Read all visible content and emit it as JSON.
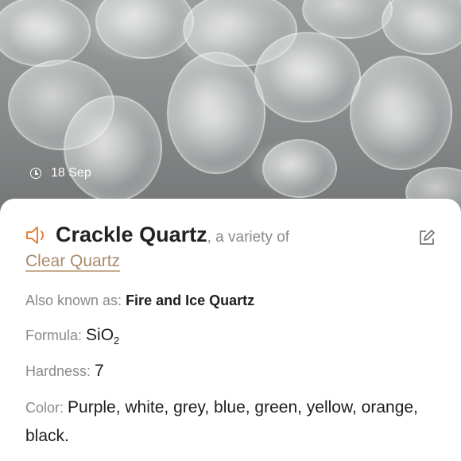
{
  "header": {
    "date": "18 Sep",
    "date_icon": "clock-icon"
  },
  "mineral": {
    "name": "Crackle Quartz",
    "variety_text": ", a variety of",
    "parent": "Clear Quartz",
    "audio_icon": "speaker-icon",
    "edit_icon": "edit-icon"
  },
  "properties": {
    "aka_label": "Also known as: ",
    "aka_value": "Fire and Ice Quartz",
    "formula_label": "Formula: ",
    "formula_main": "SiO",
    "formula_sub": "2",
    "hardness_label": "Hardness: ",
    "hardness_value": "7",
    "color_label": "Color: ",
    "color_value": "Purple, white, grey, blue, green, yellow, orange, black."
  },
  "colors": {
    "accent": "#e8803c",
    "link": "#a88a6c"
  }
}
